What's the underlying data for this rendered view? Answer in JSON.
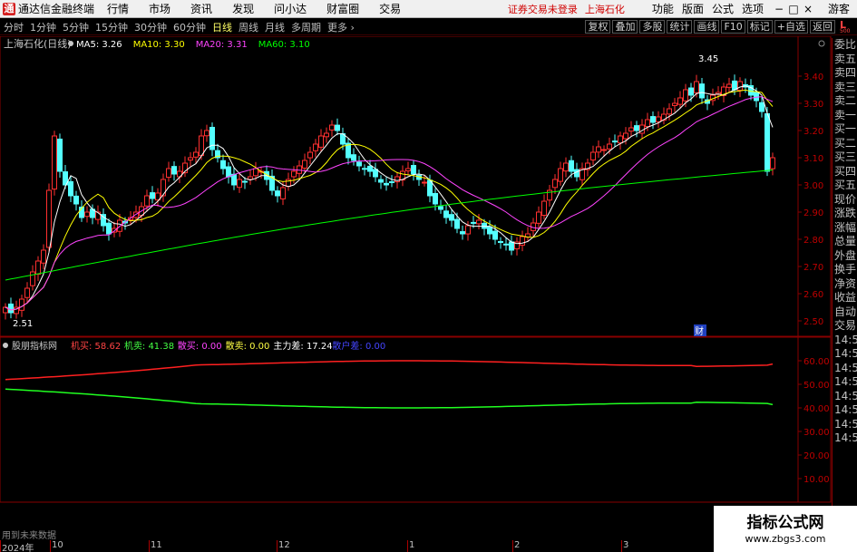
{
  "menubar": {
    "app_title": "通达信金融终端",
    "menus": [
      "行情",
      "市场",
      "资讯",
      "发现",
      "问小达",
      "财富圈",
      "交易"
    ],
    "status": "证券交易未登录",
    "stock_name": "上海石化",
    "right_menus": [
      "功能",
      "版面",
      "公式",
      "选项"
    ],
    "guest": "游客"
  },
  "periods": [
    "分时",
    "1分钟",
    "5分钟",
    "15分钟",
    "30分钟",
    "60分钟",
    "日线",
    "周线",
    "月线",
    "多周期",
    "更多"
  ],
  "active_period": "日线",
  "toolbar_buttons": [
    "复权",
    "叠加",
    "多股",
    "统计",
    "画线",
    "F10",
    "标记",
    "+自选",
    "返回"
  ],
  "badge": {
    "letter": "L",
    "num": "500"
  },
  "main_chart": {
    "title": "上海石化(日线)",
    "ma": [
      {
        "label": "MA5: 3.26",
        "color": "#ffffff"
      },
      {
        "label": "MA10: 3.30",
        "color": "#ffff00"
      },
      {
        "label": "MA20: 3.31",
        "color": "#ff44ff"
      },
      {
        "label": "MA60: 3.10",
        "color": "#00ff00"
      }
    ],
    "high_label": "3.45",
    "low_label": "2.51",
    "cai_label": "财"
  },
  "indicator": {
    "name": "股朋指标网",
    "items": [
      {
        "label": "机买: 58.62",
        "color": "#ff4444"
      },
      {
        "label": "机卖: 41.38",
        "color": "#44ff44"
      },
      {
        "label": "散买: 0.00",
        "color": "#ff44ff"
      },
      {
        "label": "散卖: 0.00",
        "color": "#ffff44"
      },
      {
        "label": "主力差: 17.24",
        "color": "#ffffff"
      },
      {
        "label": "散户差: 0.00",
        "color": "#4444ff"
      }
    ]
  },
  "quote_labels": [
    "委比",
    "卖五",
    "卖四",
    "卖三",
    "卖二",
    "卖一",
    "买一",
    "买二",
    "买三",
    "买四",
    "买五",
    "现价",
    "涨跌",
    "涨幅",
    "总量",
    "外盘",
    "换手",
    "净资",
    "收益",
    "自动",
    "交易"
  ],
  "time_labels": [
    "14:56",
    "14:56",
    "14:56",
    "14:56",
    "14:56",
    "14:56",
    "14:56",
    "14:56"
  ],
  "axis_dates": [
    "2024年",
    "10",
    "11",
    "12",
    "1",
    "2",
    "3"
  ],
  "future_note": "用到未来数据",
  "watermark": {
    "title": "指标公式网",
    "url": "www.zbgs3.com"
  },
  "chart_data": [
    {
      "type": "candlestick",
      "title": "上海石化(日线)",
      "y_ticks": [
        2.5,
        2.6,
        2.7,
        2.8,
        2.9,
        3.0,
        3.1,
        3.2,
        3.3,
        3.4
      ],
      "ylim": [
        2.46,
        3.5
      ],
      "x_labels": [
        "2024年",
        "10",
        "11",
        "12",
        "1",
        "2",
        "3"
      ],
      "max": 3.45,
      "min": 2.51,
      "closes": [
        2.55,
        2.53,
        2.55,
        2.58,
        2.62,
        2.68,
        2.72,
        2.76,
        2.98,
        3.18,
        3.05,
        3.0,
        2.96,
        2.93,
        2.88,
        2.9,
        2.88,
        2.9,
        2.85,
        2.82,
        2.84,
        2.87,
        2.86,
        2.88,
        2.9,
        2.92,
        2.96,
        2.95,
        2.97,
        3.02,
        3.06,
        3.04,
        3.05,
        3.08,
        3.1,
        3.12,
        3.18,
        3.2,
        3.13,
        3.1,
        3.06,
        3.03,
        3.0,
        3.02,
        3.01,
        3.03,
        3.06,
        3.05,
        3.02,
        2.98,
        2.96,
        2.99,
        3.02,
        3.05,
        3.07,
        3.09,
        3.12,
        3.15,
        3.18,
        3.19,
        3.22,
        3.2,
        3.15,
        3.1,
        3.09,
        3.07,
        3.06,
        3.05,
        3.03,
        3.01,
        3.0,
        3.01,
        3.03,
        3.05,
        3.06,
        3.04,
        3.02,
        3.01,
        2.96,
        2.93,
        2.91,
        2.88,
        2.87,
        2.84,
        2.82,
        2.85,
        2.86,
        2.87,
        2.84,
        2.82,
        2.8,
        2.79,
        2.78,
        2.76,
        2.79,
        2.81,
        2.82,
        2.86,
        2.9,
        2.94,
        2.98,
        3.02,
        3.06,
        3.08,
        3.05,
        3.03,
        3.06,
        3.08,
        3.12,
        3.14,
        3.13,
        3.15,
        3.16,
        3.18,
        3.19,
        3.21,
        3.2,
        3.22,
        3.24,
        3.23,
        3.25,
        3.26,
        3.28,
        3.3,
        3.32,
        3.35,
        3.33,
        3.38,
        3.32,
        3.3,
        3.33,
        3.34,
        3.36,
        3.37,
        3.35,
        3.38,
        3.36,
        3.33,
        3.31,
        3.27,
        3.05,
        3.1
      ],
      "ma60_ends": [
        2.65,
        3.1
      ]
    },
    {
      "type": "line",
      "series": [
        {
          "name": "机买"
        },
        {
          "name": "机卖"
        }
      ],
      "y_ticks": [
        10.0,
        20.0,
        30.0,
        40.0,
        50.0,
        60.0
      ],
      "ylim": [
        0,
        65
      ],
      "last_values": [
        58.62,
        41.38
      ]
    }
  ]
}
